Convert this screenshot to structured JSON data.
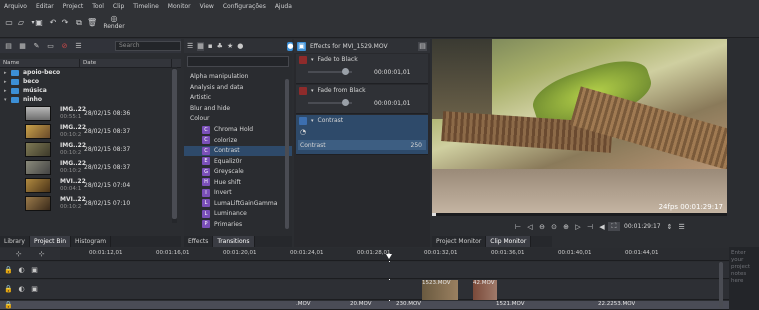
{
  "menu": [
    "Arquivo",
    "Editar",
    "Project",
    "Tool",
    "Clip",
    "Timeline",
    "Monitor",
    "View",
    "Configurações",
    "Ajuda"
  ],
  "toolbar": {
    "render_label": "Render"
  },
  "bin": {
    "search_placeholder": "Search",
    "col_name": "Name",
    "col_date": "Date",
    "folders": [
      "apoio-beco",
      "beco",
      "música",
      "ninho"
    ],
    "clips": [
      {
        "name": "IMG..22",
        "dur": "00:55:1",
        "date": "28/02/15 08:36"
      },
      {
        "name": "IMG..22",
        "dur": "00:10:2",
        "date": "28/02/15 08:37"
      },
      {
        "name": "IMG..22",
        "dur": "00:10:2",
        "date": "28/02/15 08:37"
      },
      {
        "name": "IMG..22",
        "dur": "00:10:2",
        "date": "28/02/15 08:37"
      },
      {
        "name": "MVI..22",
        "dur": "00:04:1",
        "date": "28/02/15 07:04"
      },
      {
        "name": "MVI..22",
        "dur": "00:10:2",
        "date": "28/02/15 07:10"
      }
    ]
  },
  "left_tabs": [
    "Library",
    "Project Bin",
    "Histogram"
  ],
  "effects_list": {
    "categories": [
      "Alpha manipulation",
      "Analysis and data",
      "Artistic",
      "Blur and hide",
      "Colour"
    ],
    "colour_items": [
      "Chroma Hold",
      "colorize",
      "Contrast",
      "Equaliz0r",
      "Greyscale",
      "Hue shift",
      "Invert",
      "LumaLiftGainGamma",
      "Luminance",
      "Primaries"
    ],
    "selected": "Contrast"
  },
  "mid_tabs": [
    "Effects",
    "Transitions"
  ],
  "stack": {
    "title": "Effects for MVI_1529.MOV",
    "effects": [
      {
        "name": "Fade to Black",
        "time": "00:00:01,01"
      },
      {
        "name": "Fade from Black",
        "time": "00:00:01,01"
      }
    ],
    "contrast": {
      "name": "Contrast",
      "param": "Contrast",
      "value": "250"
    }
  },
  "monitor": {
    "overlay": "24fps 00:01:29:17",
    "timecode": "00:01:29:17",
    "tabs": [
      "Project Monitor",
      "Clip Monitor"
    ],
    "side_note": "Enter your project notes here"
  },
  "timeline": {
    "ticks": [
      "00:01:12,01",
      "00:01:16,01",
      "00:01:20,01",
      "00:01:24,01",
      "00:01:28,01",
      "00:01:32,01",
      "00:01:36,01",
      "00:01:40,01",
      "00:01:44,01"
    ],
    "clips_top": [
      "1523.MOV",
      "42.MOV"
    ],
    "clips_bottom": [
      ".MOV",
      "20.MOV",
      "230.MOV",
      "1521.MOV",
      "22.2253.MOV"
    ]
  },
  "colors": {
    "accent": "#3c8fd6",
    "selection": "#2e4a6a",
    "effect_icon": "#7a4fb8"
  }
}
